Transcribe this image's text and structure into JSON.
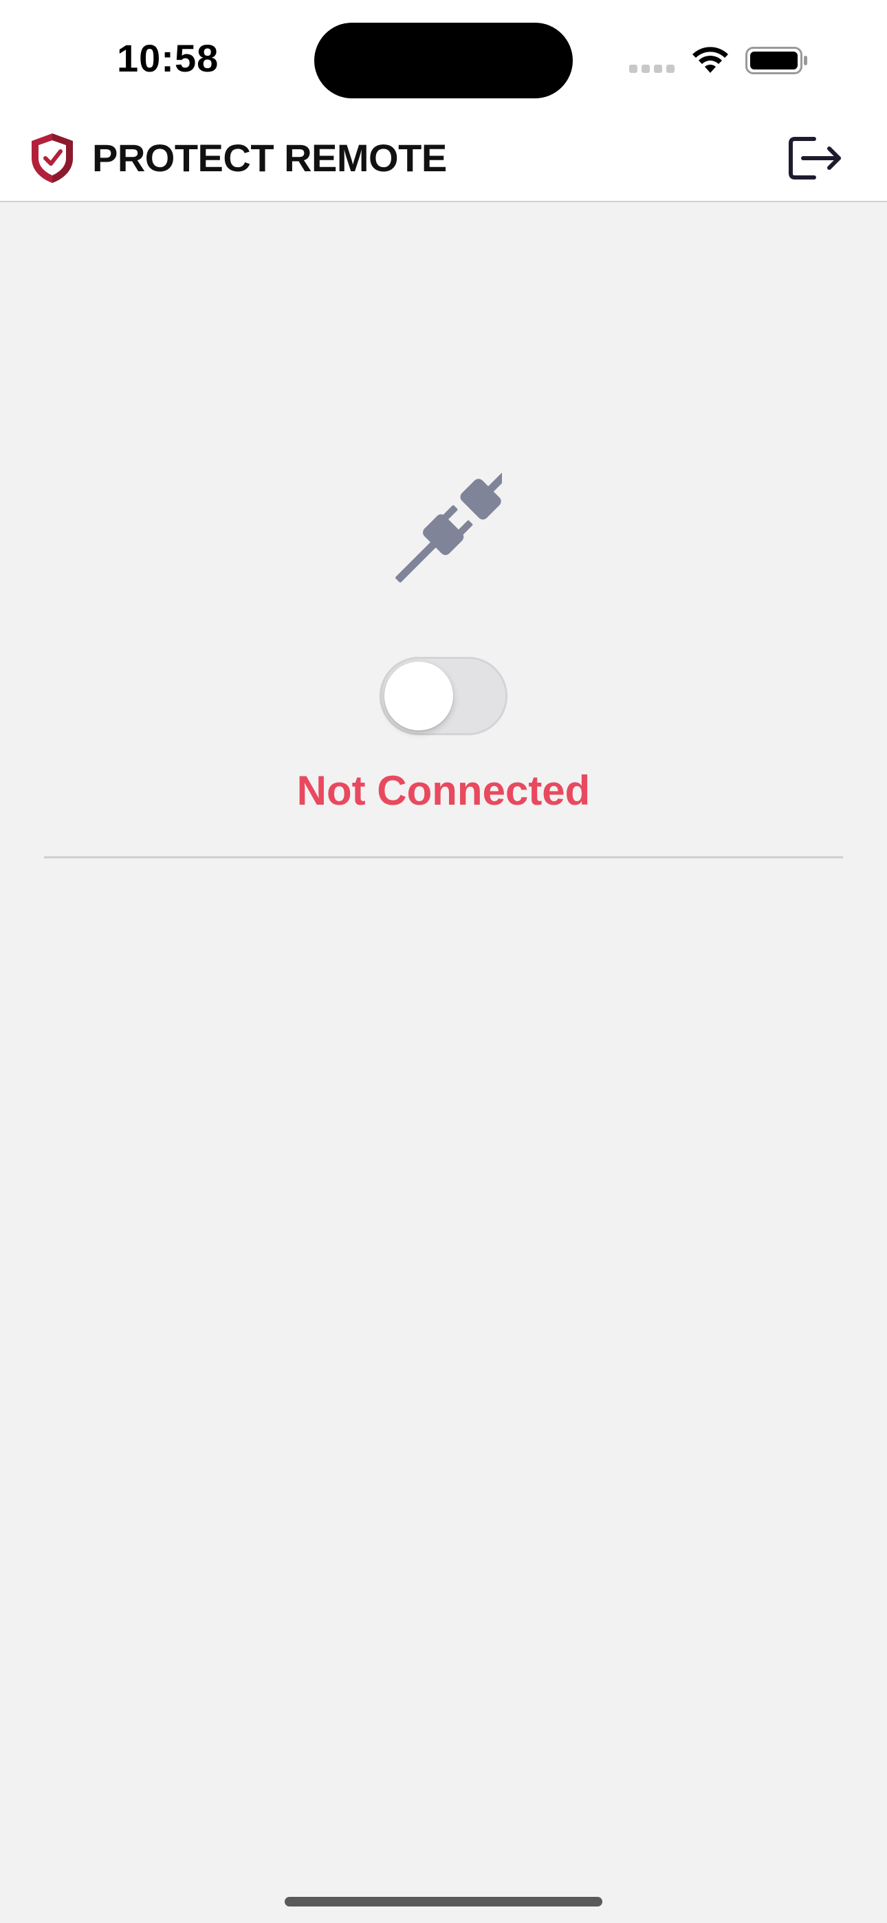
{
  "status_bar": {
    "time": "10:58",
    "icons": [
      "signal-icon",
      "wifi-icon",
      "battery-icon"
    ]
  },
  "header": {
    "title": "PROTECT REMOTE",
    "logo_icon": "shield-check-icon",
    "logout_icon": "logout-icon"
  },
  "connection": {
    "icon": "plug-disconnected-icon",
    "toggle_on": false,
    "status": "Not Connected"
  },
  "colors": {
    "brand_red": "#b3203a",
    "status_red": "#e8495e",
    "plug_gray": "#7f8499",
    "background": "#f2f2f2"
  }
}
